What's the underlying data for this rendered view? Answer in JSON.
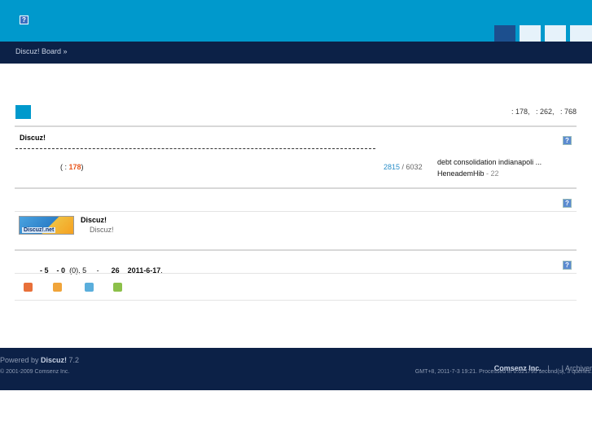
{
  "header": {
    "logo_glyph": "?",
    "accent_color": "#0099cc",
    "nav_color": "#0c2147"
  },
  "nav": {
    "breadcrumb": "Discuz! Board »"
  },
  "stats": {
    "text": ": 178,   : 262,   : 768"
  },
  "forum_section": {
    "title": "Discuz!",
    "help_glyph": "?",
    "row": {
      "prefix": "(  : ",
      "today": "178",
      "suffix": ")",
      "threads": "2815",
      "sep": " / ",
      "posts": "6032",
      "last_title": "debt consolidation indianapoli ...",
      "last_user": "HeneademHib",
      "last_time": " - 22"
    }
  },
  "links_section": {
    "help_glyph": "?",
    "logo_text": "Discuz!.net",
    "name": "Discuz!",
    "desc": "Discuz!"
  },
  "online_section": {
    "help_glyph": "?",
    "text_a": "- 5",
    "text_b": "- 0",
    "text_c": "(0",
    "text_d": "), 5",
    "text_e": "-",
    "text_f": "26",
    "date": "2011-6-17",
    "date_suffix": ".",
    "icons": [
      {
        "name": "admin-user-icon",
        "color": "#e8703a"
      },
      {
        "name": "moderator-user-icon",
        "color": "#f0a43a"
      },
      {
        "name": "member-user-icon",
        "color": "#5aaedc"
      },
      {
        "name": "guest-user-icon",
        "color": "#8cc04a"
      }
    ]
  },
  "footer": {
    "powered": "Powered by ",
    "brand": "Discuz!",
    "version": " 7.2",
    "copyright": "© 2001-2009 Comsenz Inc.",
    "company": "Comsenz Inc.",
    "sep1": "|",
    "archiver": "| Archiver",
    "stats": "GMT+8, 2011-7-3 19:21. Processed in 0.021795 second(s), 3 queries."
  }
}
